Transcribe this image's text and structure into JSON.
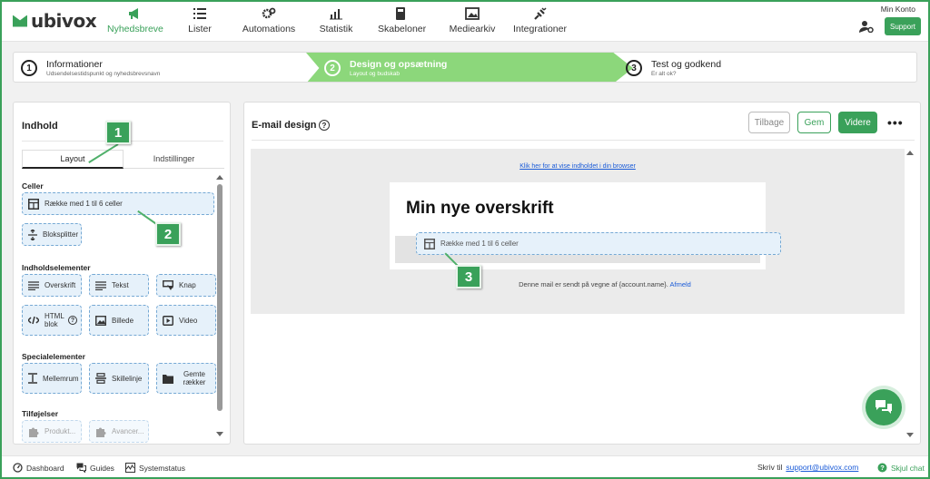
{
  "brand": {
    "name": "ubivox",
    "accent": "#3aa15a",
    "step_active_color": "#8cd77b",
    "link_color": "#1a5bd8"
  },
  "nav": [
    {
      "label": "Nyhedsbreve",
      "icon": "megaphone-icon",
      "active": true
    },
    {
      "label": "Lister",
      "icon": "list-icon",
      "active": false
    },
    {
      "label": "Automations",
      "icon": "gears-icon",
      "active": false
    },
    {
      "label": "Statistik",
      "icon": "bar-chart-icon",
      "active": false
    },
    {
      "label": "Skabeloner",
      "icon": "template-icon",
      "active": false
    },
    {
      "label": "Mediearkiv",
      "icon": "image-icon",
      "active": false
    },
    {
      "label": "Integrationer",
      "icon": "plug-icon",
      "active": false
    }
  ],
  "account": {
    "label": "Min Konto",
    "support_label": "Support"
  },
  "steps": [
    {
      "num": "1",
      "title": "Informationer",
      "subtitle": "Udsendelsestidspunkt og nyhedsbrevsnavn"
    },
    {
      "num": "2",
      "title": "Design og opsætning",
      "subtitle": "Layout og budskab"
    },
    {
      "num": "3",
      "title": "Test og godkend",
      "subtitle": "Er alt ok?"
    }
  ],
  "left": {
    "title": "Indhold",
    "tabs": [
      "Layout",
      "Indstillinger"
    ],
    "sections": {
      "celler": "Celler",
      "indhold": "Indholdselementer",
      "special": "Specialelementer",
      "tilfoejelser": "Tilføjelser"
    },
    "tiles": {
      "row": "Række med 1 til 6 celler",
      "splitter": "Bloksplitter",
      "headline": "Overskrift",
      "text": "Tekst",
      "button": "Knap",
      "html": "HTML blok",
      "image": "Billede",
      "video": "Video",
      "spacer": "Mellemrum",
      "divider": "Skillelinje",
      "saved": "Gemte rækker",
      "product": "Produkt...",
      "advanced": "Avancer..."
    }
  },
  "right": {
    "title": "E-mail design",
    "buttons": {
      "back": "Tilbage",
      "save": "Gem",
      "next": "Videre",
      "more": "•••"
    },
    "browser_link": "Klik her for at vise indholdet i din browser",
    "headline": "Min nye overskrift",
    "drop_label": "Række med 1 til 6 celler",
    "footer_text": "Denne mail er sendt på vegne af {account.name}.",
    "unsubscribe": "Afmeld"
  },
  "callouts": [
    "1",
    "2",
    "3"
  ],
  "bottom": {
    "dashboard": "Dashboard",
    "guides": "Guides",
    "status": "Systemstatus",
    "write_to": "Skriv til",
    "email": "support@ubivox.com",
    "hide_chat": "Skjul chat"
  }
}
